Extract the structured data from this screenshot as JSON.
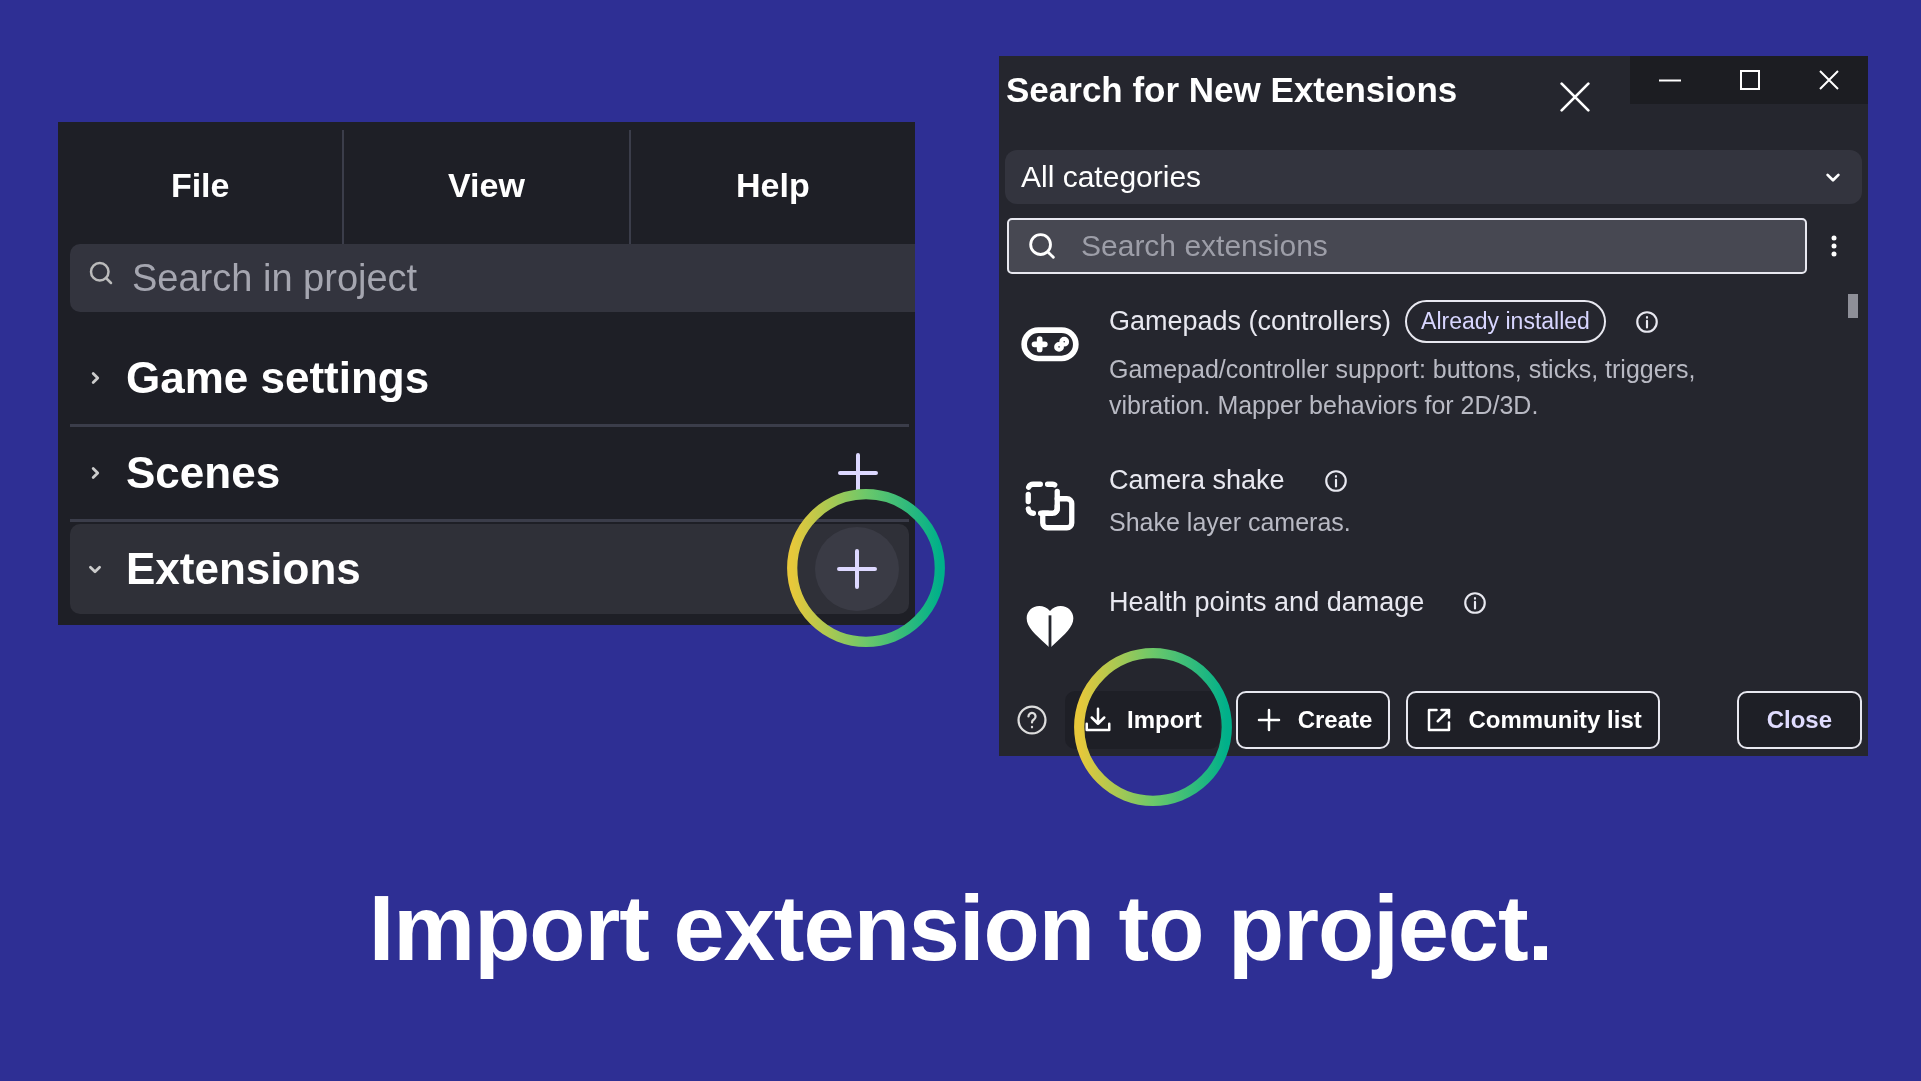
{
  "left_panel": {
    "menu": [
      "File",
      "View",
      "Help"
    ],
    "search": {
      "placeholder": "Search in project"
    },
    "sections": [
      {
        "label": "Game settings",
        "expanded": false,
        "selected": false,
        "add_button": false,
        "highlighted": false
      },
      {
        "label": "Scenes",
        "expanded": false,
        "selected": false,
        "add_button": true,
        "highlighted": false
      },
      {
        "label": "Extensions",
        "expanded": true,
        "selected": true,
        "add_button": true,
        "highlighted": true
      }
    ]
  },
  "dialog": {
    "title": "Search for New Extensions",
    "category": "All categories",
    "search": {
      "placeholder": "Search extensions"
    },
    "extensions": [
      {
        "name": "Gamepads (controllers)",
        "badge": "Already installed",
        "description": "Gamepad/controller support: buttons, sticks, triggers, vibration. Mapper behaviors for 2D/3D."
      },
      {
        "name": "Camera shake",
        "description": "Shake layer cameras."
      },
      {
        "name": "Health points and damage"
      }
    ],
    "buttons": [
      {
        "kind": "import",
        "label": "Import",
        "highlighted": true
      },
      {
        "kind": "create",
        "label": "Create",
        "highlighted": false
      },
      {
        "kind": "external",
        "label": "Community list",
        "highlighted": false
      }
    ],
    "close": "Close"
  },
  "caption": "Import extension to project."
}
